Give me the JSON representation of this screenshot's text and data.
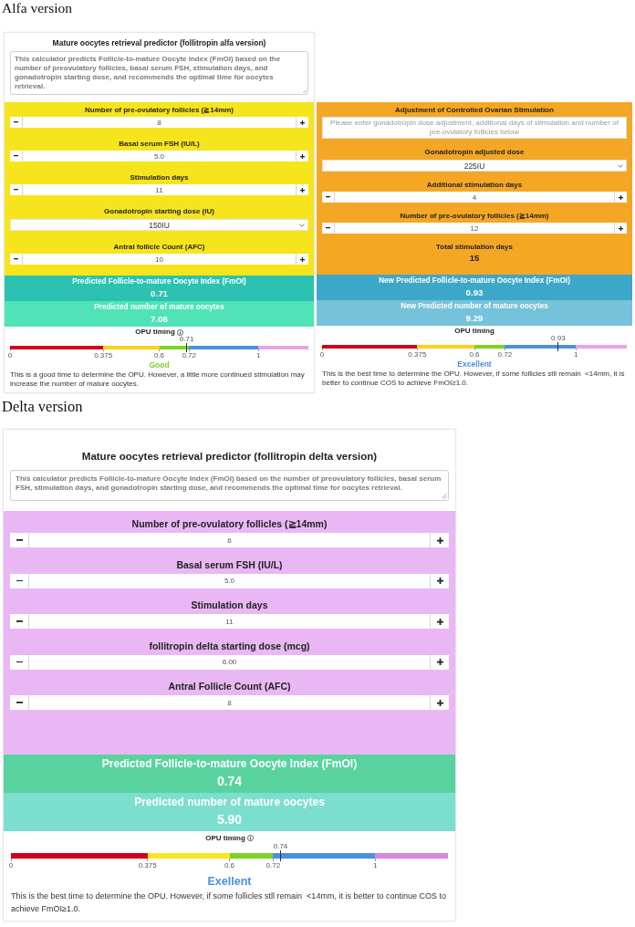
{
  "sections": [
    {
      "heading": "Alfa version",
      "panels": [
        {
          "kind": "predictor",
          "title": "Mature oocytes retrieval predictor (follitropin alfa version)",
          "description": "This calculator predicts Follicle-to-mature Oocyte Index (FmOI) based on the number of preovulatory follicles, basal serum FSH, stimulation days, and gonadotropin starting dose, and recommends the optimal time for oocytes retrieval.",
          "color": "#f6e51c",
          "inputs": [
            {
              "kind": "stepper",
              "label": "Number of pre-ovulatory follicles (≧14mm)",
              "value": "8"
            },
            {
              "kind": "stepper",
              "label": "Basal serum FSH (IU/L)",
              "value": "5.0"
            },
            {
              "kind": "stepper",
              "label": "Stimulation days",
              "value": "11"
            },
            {
              "kind": "select",
              "label": "Gonadotropin starting dose (IU)",
              "value": "150IU"
            },
            {
              "kind": "stepper",
              "label": "Antral follicle Count (AFC)",
              "value": "10"
            }
          ],
          "results": [
            {
              "label": "Predicted Follicle-to-mature Oocyte Index (FmOI)",
              "value": "0.71",
              "color": "#2bc2b1"
            },
            {
              "label": "Predicted number of mature oocytes",
              "value": "7.08",
              "color": "#50e3b7"
            }
          ],
          "opu": {
            "label": "OPU timing",
            "info_icon": true,
            "scale": {
              "zones": [
                {
                  "tick": "0",
                  "level": 0,
                  "color": "#d0021b"
                },
                {
                  "tick": "0.375",
                  "level": 0.3125,
                  "color": "#f8d21c"
                },
                {
                  "tick": "0.6",
                  "level": 0.5,
                  "color": "#7ed321"
                },
                {
                  "tick": "0.72",
                  "level": 0.6,
                  "color": "#4a90e2"
                },
                {
                  "tick": "1",
                  "level": 0.8333,
                  "color": "#eba2e7"
                }
              ],
              "marker": {
                "label": "0.71",
                "level": 0.592
              }
            },
            "verdict": {
              "text": "Good",
              "color": "#7ed321"
            },
            "note": "This is a good time to determine the OPU. However, a little more continued stimulation may increase the number of mature oocytes."
          }
        },
        {
          "kind": "adjustment",
          "color": "#f4a724",
          "inputs": [
            {
              "kind": "intro",
              "label": "Adjustment of Controlled Ovarian Stimulation",
              "placeholder": "Please enter gonadotropin dose adjustment, additional days of stimulation and number of pre-ovulatory follicles below"
            },
            {
              "kind": "select",
              "label": "Gonadotropin adjusted dose",
              "value": "225IU"
            },
            {
              "kind": "stepper",
              "label": "Additional stimulation days",
              "value": "4"
            },
            {
              "kind": "stepper",
              "label": "Number of pre-ovulatory follicles (≧14mm)",
              "value": "12"
            },
            {
              "kind": "readout",
              "label": "Total stimulation days",
              "value": "15"
            }
          ],
          "results": [
            {
              "label": "New Predicted Follicle-to-mature Oocyte Index (FmOI)",
              "value": "0.93",
              "color": "#3da7ca"
            },
            {
              "label": "New Predicted number of mature oocytes",
              "value": "9.29",
              "color": "#77c2db"
            }
          ],
          "opu": {
            "label": "OPU timing",
            "info_icon": false,
            "scale": {
              "zones": [
                {
                  "tick": "0",
                  "level": 0,
                  "color": "#d0021b"
                },
                {
                  "tick": "0.375",
                  "level": 0.3125,
                  "color": "#f8d21c"
                },
                {
                  "tick": "0.6",
                  "level": 0.5,
                  "color": "#7ed321"
                },
                {
                  "tick": "0.72",
                  "level": 0.6,
                  "color": "#4a90e2"
                },
                {
                  "tick": "1",
                  "level": 0.8333,
                  "color": "#eba2e7"
                }
              ],
              "marker": {
                "label": "0.93",
                "level": 0.775
              }
            },
            "verdict": {
              "text": "Excellent",
              "color": "#4a90e2"
            },
            "note": "This is the best time to determine the OPU. However, if some follicles stll remain  <14mm, it is better to continue COS to achieve FmOI≥1.0."
          }
        }
      ]
    },
    {
      "heading": "Delta version",
      "panels": [
        {
          "kind": "predictor",
          "title": "Mature oocytes retrieval predictor (follitropin delta version)",
          "description": "This calculator predicts Follicle-to-mature Oocyte Index (FmOI) based on the number of preovulatory follicles, basal serum FSH, stimulation days, and gonadotropin starting dose, and recommends the optimal time for oocytes retrieval.",
          "color": "#e9b8f4",
          "inputs": [
            {
              "kind": "stepper",
              "label": "Number of pre-ovulatory follicles (≧14mm)",
              "value": "6"
            },
            {
              "kind": "stepper",
              "label": "Basal serum FSH (IU/L)",
              "value": "5.0"
            },
            {
              "kind": "stepper",
              "label": "Stimulation days",
              "value": "11"
            },
            {
              "kind": "stepper",
              "label": "follitropin delta starting dose (mcg)",
              "value": "6.00"
            },
            {
              "kind": "stepper",
              "label": "Antral Follicle Count (AFC)",
              "value": "8"
            }
          ],
          "results": [
            {
              "label": "Predicted Follicle-to-mature Oocyte Index (FmOI)",
              "value": "0.74",
              "color": "#58d39f"
            },
            {
              "label": "Predicted number of mature oocytes",
              "value": "5.90",
              "color": "#7cdecf"
            }
          ],
          "opu": {
            "label": "OPU timing",
            "info_icon": true,
            "scale": {
              "zones": [
                {
                  "tick": "0",
                  "level": 0,
                  "color": "#d0021b"
                },
                {
                  "tick": "0.375",
                  "level": 0.3125,
                  "color": "#f8e71c"
                },
                {
                  "tick": "0.6",
                  "level": 0.5,
                  "color": "#7ed321"
                },
                {
                  "tick": "0.72",
                  "level": 0.6,
                  "color": "#4a90e2"
                },
                {
                  "tick": "1",
                  "level": 0.8333,
                  "color": "#d886dc"
                }
              ],
              "marker": {
                "label": "0.74",
                "level": 0.617
              }
            },
            "verdict": {
              "text": "Exellent",
              "color": "#4a90e2"
            },
            "note": "This is the best time to determine the OPU. However, if some follicles stll remain  <14mm, it is better to continue COS to achieve FmOI≥1.0."
          }
        }
      ]
    }
  ]
}
